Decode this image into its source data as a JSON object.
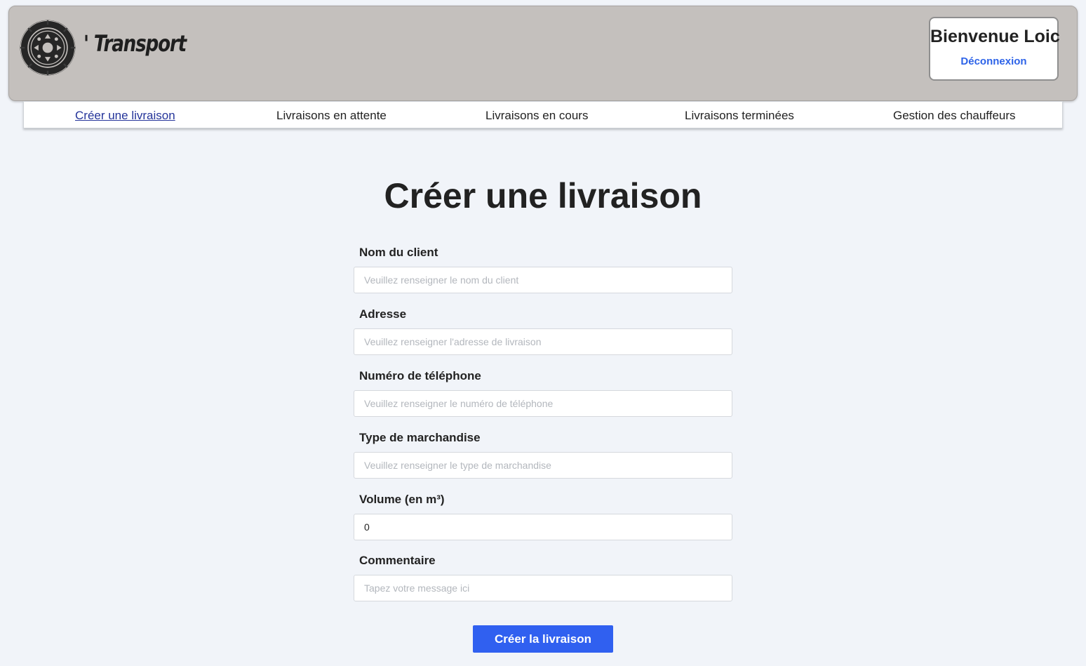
{
  "header": {
    "brand": "' Transport",
    "logo_icon": "tire-wheel-icon",
    "welcome": "Bienvenue Loic",
    "logout": "Déconnexion"
  },
  "nav": {
    "items": [
      {
        "label": "Créer une livraison",
        "active": true
      },
      {
        "label": "Livraisons en attente",
        "active": false
      },
      {
        "label": "Livraisons en cours",
        "active": false
      },
      {
        "label": "Livraisons terminées",
        "active": false
      },
      {
        "label": "Gestion des chauffeurs",
        "active": false
      }
    ]
  },
  "page": {
    "title": "Créer une livraison"
  },
  "form": {
    "fields": [
      {
        "label": "Nom du client",
        "placeholder": "Veuillez renseigner le nom du client",
        "value": ""
      },
      {
        "label": "Adresse",
        "placeholder": "Veuillez renseigner l'adresse de livraison",
        "value": ""
      },
      {
        "label": "Numéro de téléphone",
        "placeholder": "Veuillez renseigner le numéro de téléphone",
        "value": ""
      },
      {
        "label": "Type de marchandise",
        "placeholder": "Veuillez renseigner le type de marchandise",
        "value": ""
      },
      {
        "label": "Volume (en m³)",
        "placeholder": "",
        "value": "0"
      },
      {
        "label": "Commentaire",
        "placeholder": "Tapez votre message ici",
        "value": ""
      }
    ],
    "submit_label": "Créer la livraison"
  },
  "colors": {
    "header_bg": "#c4c0bd",
    "page_bg": "#f1f4f9",
    "accent": "#3060f0",
    "active_link": "#24349a",
    "logout_link": "#2d63e8"
  }
}
